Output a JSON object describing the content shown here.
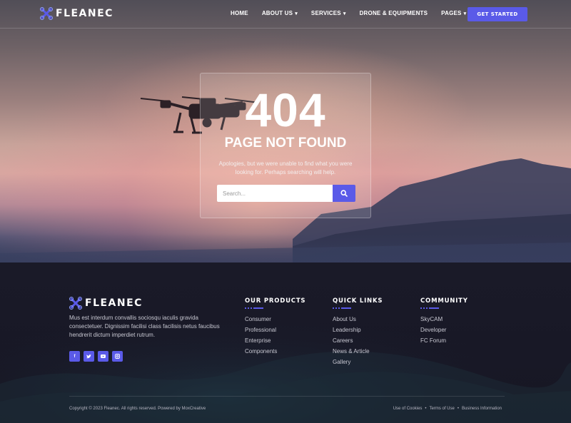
{
  "brand": {
    "name": "FLEANEC",
    "accent": "#5a5ae8"
  },
  "header": {
    "nav": [
      {
        "label": "HOME",
        "dropdown": false
      },
      {
        "label": "ABOUT US",
        "dropdown": true
      },
      {
        "label": "SERVICES",
        "dropdown": true
      },
      {
        "label": "DRONE & EQUIPMENTS",
        "dropdown": false
      },
      {
        "label": "PAGES",
        "dropdown": true
      }
    ],
    "cta": "GET STARTED"
  },
  "error": {
    "code": "404",
    "title": "PAGE NOT FOUND",
    "message": "Apologies, but we were unable to find what you were looking for. Perhaps searching will help.",
    "search_placeholder": "Search..."
  },
  "footer": {
    "about": "Mus est interdum convallis sociosqu iaculis gravida consectetuer. Dignissim facilisi class facilisis netus faucibus hendrerit dictum imperdiet rutrum.",
    "socials": [
      "facebook-icon",
      "twitter-icon",
      "youtube-icon",
      "instagram-icon"
    ],
    "columns": [
      {
        "title": "OUR PRODUCTS",
        "links": [
          "Consumer",
          "Professional",
          "Enterprise",
          "Components"
        ]
      },
      {
        "title": "QUICK LINKS",
        "links": [
          "About Us",
          "Leadership",
          "Careers",
          "News & Article",
          "Gallery"
        ]
      },
      {
        "title": "COMMUNITY",
        "links": [
          "SkyCAM",
          "Developer",
          "FC Forum"
        ]
      }
    ],
    "copyright": "Copyright © 2023 Fleanec. All rights reserved. Powered by MoxCreative",
    "legal": [
      "Use of Cookies",
      "Terms of Use",
      "Business Information"
    ]
  }
}
